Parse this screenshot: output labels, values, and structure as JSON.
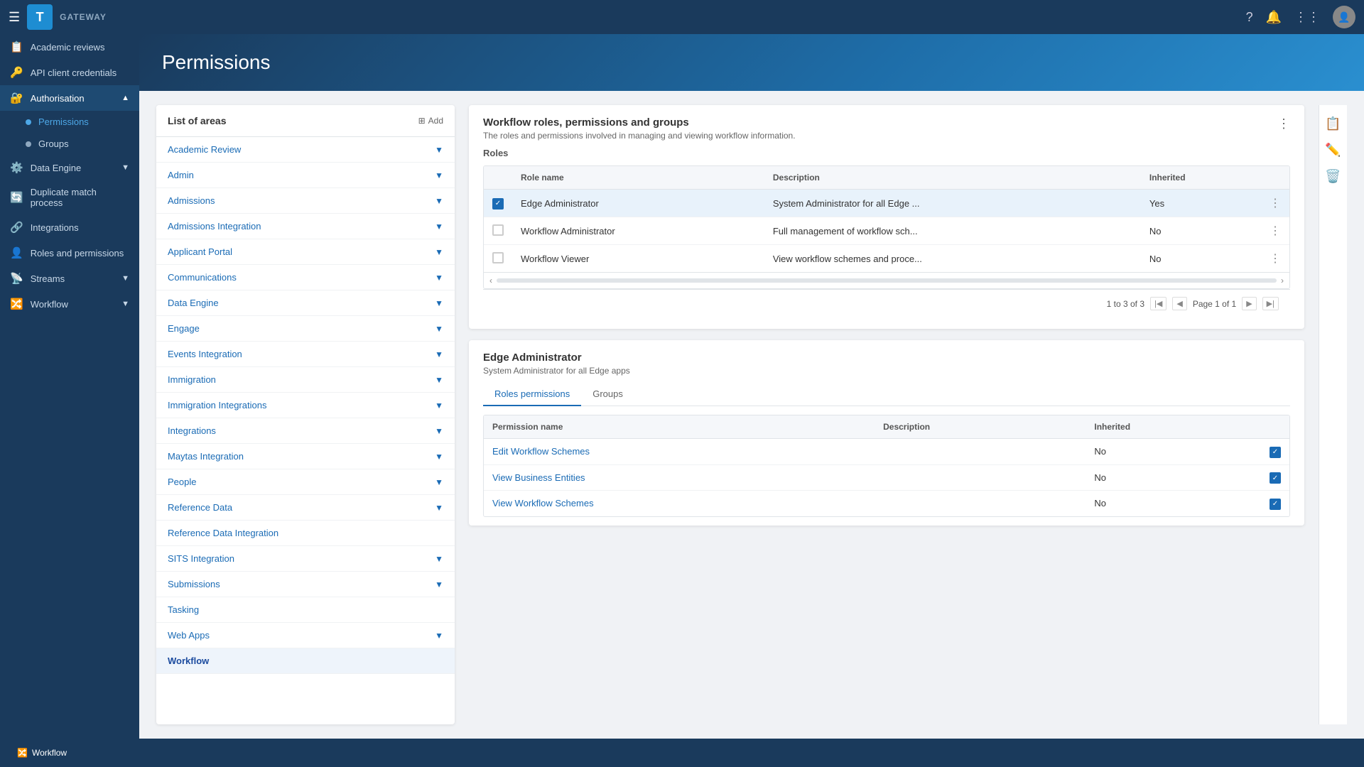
{
  "app": {
    "logo": "T",
    "gateway_label": "GATEWAY"
  },
  "topnav": {
    "icons": [
      "help",
      "bell",
      "grid",
      "avatar"
    ]
  },
  "sidebar": {
    "items": [
      {
        "id": "academic-reviews",
        "label": "Academic reviews",
        "icon": "📋",
        "hasArrow": false
      },
      {
        "id": "api-client-credentials",
        "label": "API client credentials",
        "icon": "🔑",
        "hasArrow": false
      },
      {
        "id": "authorisation",
        "label": "Authorisation",
        "icon": "🔐",
        "hasArrow": true,
        "expanded": true
      },
      {
        "id": "permissions",
        "label": "Permissions",
        "icon": "",
        "isSubItem": true,
        "isActive": true
      },
      {
        "id": "groups",
        "label": "Groups",
        "icon": "",
        "isSubItem": true
      },
      {
        "id": "data-engine",
        "label": "Data Engine",
        "icon": "⚙️",
        "hasArrow": true
      },
      {
        "id": "duplicate-match-process",
        "label": "Duplicate match process",
        "icon": "🔄",
        "hasArrow": false
      },
      {
        "id": "integrations",
        "label": "Integrations",
        "icon": "🔗",
        "hasArrow": false
      },
      {
        "id": "roles-and-permissions",
        "label": "Roles and permissions",
        "icon": "👤",
        "hasArrow": false
      },
      {
        "id": "streams",
        "label": "Streams",
        "icon": "📡",
        "hasArrow": true
      },
      {
        "id": "workflow",
        "label": "Workflow",
        "icon": "🔀",
        "hasArrow": true
      }
    ]
  },
  "page_header": {
    "title": "Permissions"
  },
  "areas_panel": {
    "title": "List of areas",
    "add_button_label": "Add",
    "areas": [
      {
        "name": "Academic Review",
        "has_chevron": true
      },
      {
        "name": "Admin",
        "has_chevron": true
      },
      {
        "name": "Admissions",
        "has_chevron": true
      },
      {
        "name": "Admissions Integration",
        "has_chevron": true
      },
      {
        "name": "Applicant Portal",
        "has_chevron": true
      },
      {
        "name": "Communications",
        "has_chevron": true
      },
      {
        "name": "Data Engine",
        "has_chevron": true
      },
      {
        "name": "Engage",
        "has_chevron": true
      },
      {
        "name": "Events Integration",
        "has_chevron": true
      },
      {
        "name": "Immigration",
        "has_chevron": true
      },
      {
        "name": "Immigration Integrations",
        "has_chevron": true
      },
      {
        "name": "Integrations",
        "has_chevron": true
      },
      {
        "name": "Maytas Integration",
        "has_chevron": true
      },
      {
        "name": "People",
        "has_chevron": true
      },
      {
        "name": "Reference Data",
        "has_chevron": true
      },
      {
        "name": "Reference Data Integration",
        "has_chevron": false
      },
      {
        "name": "SITS Integration",
        "has_chevron": true
      },
      {
        "name": "Submissions",
        "has_chevron": true
      },
      {
        "name": "Tasking",
        "has_chevron": false
      },
      {
        "name": "Web Apps",
        "has_chevron": true
      },
      {
        "name": "Workflow",
        "has_chevron": false,
        "is_selected": true
      }
    ]
  },
  "roles_card": {
    "title": "Workflow roles, permissions and groups",
    "subtitle": "The roles and permissions involved in managing and viewing workflow information.",
    "section_label": "Roles",
    "columns": [
      "",
      "Role name",
      "Description",
      "Inherited",
      ""
    ],
    "rows": [
      {
        "checked": true,
        "role_name": "Edge Administrator",
        "description": "System Administrator for all Edge ...",
        "inherited": "Yes",
        "selected": true
      },
      {
        "checked": false,
        "role_name": "Workflow Administrator",
        "description": "Full management of workflow sch...",
        "inherited": "No",
        "selected": false
      },
      {
        "checked": false,
        "role_name": "Workflow Viewer",
        "description": "View workflow schemes and proce...",
        "inherited": "No",
        "selected": false
      }
    ],
    "pagination": {
      "count_label": "1 to 3 of 3",
      "page_label": "Page 1 of 1"
    }
  },
  "role_detail": {
    "title": "Edge Administrator",
    "subtitle": "System Administrator for all Edge apps",
    "tabs": [
      {
        "label": "Roles permissions",
        "active": true
      },
      {
        "label": "Groups",
        "active": false
      }
    ],
    "permissions_columns": [
      "Permission name",
      "Description",
      "Inherited",
      ""
    ],
    "permissions_rows": [
      {
        "name": "Edit Workflow Schemes",
        "description": "",
        "inherited": "No",
        "checked": true
      },
      {
        "name": "View Business Entities",
        "description": "",
        "inherited": "No",
        "checked": true
      },
      {
        "name": "View Workflow Schemes",
        "description": "",
        "inherited": "No",
        "checked": true
      }
    ]
  },
  "bottom_nav": {
    "items": [
      {
        "label": "Workflow",
        "active": true
      }
    ]
  }
}
